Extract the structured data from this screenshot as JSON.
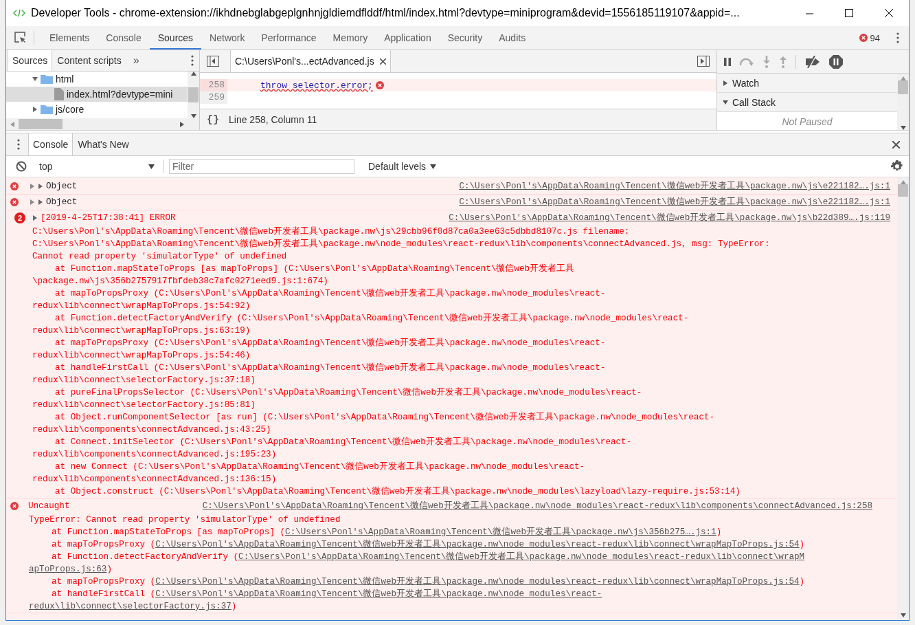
{
  "window": {
    "title": "Developer Tools - chrome-extension://ikhdnebglabgeplgnhnjgldiemdflddf/html/index.html?devtype=miniprogram&devid=1556185119107&appid=..."
  },
  "main_tabs": [
    {
      "label": "Elements",
      "selected": false
    },
    {
      "label": "Console",
      "selected": false
    },
    {
      "label": "Sources",
      "selected": true
    },
    {
      "label": "Network",
      "selected": false
    },
    {
      "label": "Performance",
      "selected": false
    },
    {
      "label": "Memory",
      "selected": false
    },
    {
      "label": "Application",
      "selected": false
    },
    {
      "label": "Security",
      "selected": false
    },
    {
      "label": "Audits",
      "selected": false
    }
  ],
  "error_count": "94",
  "navigator": {
    "tabs": [
      {
        "label": "Sources",
        "selected": true
      },
      {
        "label": "Content scripts",
        "selected": false
      }
    ],
    "more": "»",
    "tree": [
      {
        "label": "html",
        "kind": "folder",
        "expanded": true,
        "selected": false,
        "children": [
          {
            "label": "index.html?devtype=mini",
            "kind": "file",
            "selected": true
          }
        ]
      },
      {
        "label": "js/core",
        "kind": "folder",
        "expanded": false,
        "selected": false
      }
    ]
  },
  "editor": {
    "file_tab": "C:\\Users\\Ponl's...ectAdvanced.js",
    "lines": [
      {
        "number": "258",
        "code": "throw selector.error;",
        "error": true
      },
      {
        "number": "259",
        "error": false
      }
    ],
    "status": "Line 258, Column 11",
    "format_label": "{}"
  },
  "debugger": {
    "sections": [
      {
        "label": "Watch",
        "expanded": false
      },
      {
        "label": "Call Stack",
        "expanded": true
      }
    ],
    "status": "Not Paused"
  },
  "drawer": {
    "tabs": [
      {
        "label": "Console",
        "selected": true
      },
      {
        "label": "What's New",
        "selected": false
      }
    ]
  },
  "console_toolbar": {
    "context": "top",
    "filter_placeholder": "Filter",
    "levels": "Default levels"
  },
  "messages": [
    {
      "kind": "object",
      "header": "Object",
      "link": "C:\\Users\\Ponl's\\AppData\\Roaming\\Tencent\\微信web开发者工具\\package.nw\\js\\e221182….js:1"
    },
    {
      "kind": "object",
      "header": "Object",
      "link": "C:\\Users\\Ponl's\\AppData\\Roaming\\Tencent\\微信web开发者工具\\package.nw\\js\\e221182….js:1"
    },
    {
      "kind": "group",
      "count": "2",
      "header": "[2019-4-25T17:38:41] ERROR",
      "link": "C:\\Users\\Ponl's\\AppData\\Roaming\\Tencent\\微信web开发者工具\\package.nw\\js\\b22d389….js:119",
      "lines": [
        {
          "indent": false,
          "text": "C:\\Users\\Ponl's\\AppData\\Roaming\\Tencent\\微信web开发者工具\\package.nw\\js\\29cbb96f0d87ca0a3ee63c5dbbd8107c.js filename:"
        },
        {
          "indent": false,
          "text": "C:\\Users\\Ponl's\\AppData\\Roaming\\Tencent\\微信web开发者工具\\package.nw\\node_modules\\react-redux\\lib\\components\\connectAdvanced.js, msg: TypeError:"
        },
        {
          "indent": false,
          "text": "Cannot read property 'simulatorType' of undefined"
        },
        {
          "indent": true,
          "text": "at Function.mapStateToProps [as mapToProps] (C:\\Users\\Ponl's\\AppData\\Roaming\\Tencent\\微信web开发者工具"
        },
        {
          "indent": false,
          "text": "\\package.nw\\js\\356b2757917fbfdeb38c7afc0271eed9.js:1:674)"
        },
        {
          "indent": true,
          "text": "at mapToPropsProxy (C:\\Users\\Ponl's\\AppData\\Roaming\\Tencent\\微信web开发者工具\\package.nw\\node_modules\\react-"
        },
        {
          "indent": false,
          "text": "redux\\lib\\connect\\wrapMapToProps.js:54:92)"
        },
        {
          "indent": true,
          "text": "at Function.detectFactoryAndVerify (C:\\Users\\Ponl's\\AppData\\Roaming\\Tencent\\微信web开发者工具\\package.nw\\node_modules\\react-"
        },
        {
          "indent": false,
          "text": "redux\\lib\\connect\\wrapMapToProps.js:63:19)"
        },
        {
          "indent": true,
          "text": "at mapToPropsProxy (C:\\Users\\Ponl's\\AppData\\Roaming\\Tencent\\微信web开发者工具\\package.nw\\node_modules\\react-"
        },
        {
          "indent": false,
          "text": "redux\\lib\\connect\\wrapMapToProps.js:54:46)"
        },
        {
          "indent": true,
          "text": "at handleFirstCall (C:\\Users\\Ponl's\\AppData\\Roaming\\Tencent\\微信web开发者工具\\package.nw\\node_modules\\react-"
        },
        {
          "indent": false,
          "text": "redux\\lib\\connect\\selectorFactory.js:37:18)"
        },
        {
          "indent": true,
          "text": "at pureFinalPropsSelector (C:\\Users\\Ponl's\\AppData\\Roaming\\Tencent\\微信web开发者工具\\package.nw\\node_modules\\react-"
        },
        {
          "indent": false,
          "text": "redux\\lib\\connect\\selectorFactory.js:85:81)"
        },
        {
          "indent": true,
          "text": "at Object.runComponentSelector [as run] (C:\\Users\\Ponl's\\AppData\\Roaming\\Tencent\\微信web开发者工具\\package.nw\\node_modules\\react-"
        },
        {
          "indent": false,
          "text": "redux\\lib\\components\\connectAdvanced.js:43:25)"
        },
        {
          "indent": true,
          "text": "at Connect.initSelector (C:\\Users\\Ponl's\\AppData\\Roaming\\Tencent\\微信web开发者工具\\package.nw\\node_modules\\react-"
        },
        {
          "indent": false,
          "text": "redux\\lib\\components\\connectAdvanced.js:195:23)"
        },
        {
          "indent": true,
          "text": "at new Connect (C:\\Users\\Ponl's\\AppData\\Roaming\\Tencent\\微信web开发者工具\\package.nw\\node_modules\\react-"
        },
        {
          "indent": false,
          "text": "redux\\lib\\components\\connectAdvanced.js:136:15)"
        },
        {
          "indent": true,
          "text": "at Object.construct (C:\\Users\\Ponl's\\AppData\\Roaming\\Tencent\\微信web开发者工具\\package.nw\\node_modules\\lazyload\\lazy-require.js:53:14)"
        }
      ]
    },
    {
      "kind": "uncaught",
      "header": "Uncaught",
      "link": "C:\\Users\\Ponl's\\AppData\\Roaming\\Tencent\\微信web开发者工具\\package.nw\\node_modules\\react-redux\\lib\\components\\connectAdvanced.js:258",
      "lines": [
        {
          "indent": false,
          "text": "TypeError: Cannot read property 'simulatorType' of undefined"
        },
        {
          "indent": true,
          "text": "at Function.mapStateToProps [as mapToProps] (",
          "link": "C:\\Users\\Ponl's\\AppData\\Roaming\\Tencent\\微信web开发者工具\\package.nw\\js\\356b275….js:1",
          "after": ")"
        },
        {
          "indent": true,
          "text": "at mapToPropsProxy (",
          "link": "C:\\Users\\Ponl's\\AppData\\Roaming\\Tencent\\微信web开发者工具\\package.nw\\node_modules\\react-redux\\lib\\connect\\wrapMapToProps.js:54",
          "after": ")"
        },
        {
          "indent": true,
          "text": "at Function.detectFactoryAndVerify (",
          "link": "C:\\Users\\Ponl's\\AppData\\Roaming\\Tencent\\微信web开发者工具\\package.nw\\node_modules\\react-redux\\lib\\connect\\wrapM"
        },
        {
          "indent": false,
          "link": "apToProps.js:63",
          "after": ")"
        },
        {
          "indent": true,
          "text": "at mapToPropsProxy (",
          "link": "C:\\Users\\Ponl's\\AppData\\Roaming\\Tencent\\微信web开发者工具\\package.nw\\node_modules\\react-redux\\lib\\connect\\wrapMapToProps.js:54",
          "after": ")"
        },
        {
          "indent": true,
          "text": "at handleFirstCall (",
          "link": "C:\\Users\\Ponl's\\AppData\\Roaming\\Tencent\\微信web开发者工具\\package.nw\\node_modules\\react-"
        },
        {
          "indent": false,
          "link": "redux\\lib\\connect\\selectorFactory.js:37",
          "after": ")"
        }
      ]
    }
  ]
}
